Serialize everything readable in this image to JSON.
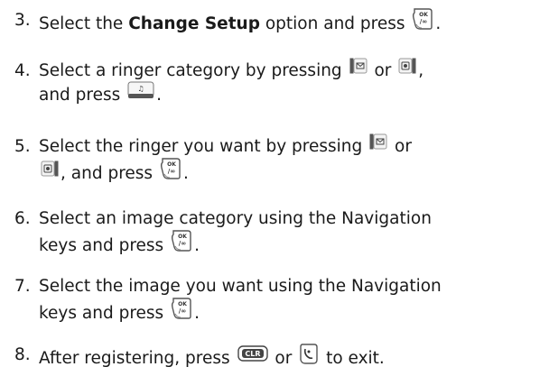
{
  "steps": [
    {
      "num": "3.",
      "parts": [
        {
          "t": "text",
          "v": "Select the "
        },
        {
          "t": "bold",
          "v": "Change Setup"
        },
        {
          "t": "text",
          "v": " option and press "
        },
        {
          "t": "icon",
          "icon": "ok-key-icon"
        },
        {
          "t": "text",
          "v": "."
        }
      ]
    },
    {
      "num": "4.",
      "parts": [
        {
          "t": "text",
          "v": "Select a ringer category by pressing "
        },
        {
          "t": "icon",
          "icon": "message-key-icon"
        },
        {
          "t": "text",
          "v": " or "
        },
        {
          "t": "icon",
          "icon": "phonebook-key-icon"
        },
        {
          "t": "text",
          "v": ","
        },
        {
          "t": "br"
        },
        {
          "t": "text",
          "v": "and press "
        },
        {
          "t": "icon",
          "icon": "music-softkey-icon"
        },
        {
          "t": "text",
          "v": "."
        }
      ]
    },
    {
      "num": "5.",
      "parts": [
        {
          "t": "text",
          "v": "Select the ringer you want by pressing "
        },
        {
          "t": "icon",
          "icon": "message-key-icon"
        },
        {
          "t": "text",
          "v": " or"
        },
        {
          "t": "br"
        },
        {
          "t": "icon",
          "icon": "phonebook-key-icon"
        },
        {
          "t": "text",
          "v": ", and press "
        },
        {
          "t": "icon",
          "icon": "ok-key-icon"
        },
        {
          "t": "text",
          "v": "."
        }
      ]
    },
    {
      "num": "6.",
      "parts": [
        {
          "t": "text",
          "v": "Select an image category using the Navigation"
        },
        {
          "t": "br"
        },
        {
          "t": "text",
          "v": "keys and press "
        },
        {
          "t": "icon",
          "icon": "ok-key-icon"
        },
        {
          "t": "text",
          "v": "."
        }
      ]
    },
    {
      "num": "7.",
      "parts": [
        {
          "t": "text",
          "v": "Select the image you want using the Navigation"
        },
        {
          "t": "br"
        },
        {
          "t": "text",
          "v": "keys and press "
        },
        {
          "t": "icon",
          "icon": "ok-key-icon"
        },
        {
          "t": "text",
          "v": "."
        }
      ]
    },
    {
      "num": "8.",
      "parts": [
        {
          "t": "text",
          "v": "After registering, press "
        },
        {
          "t": "icon",
          "icon": "clr-key-icon",
          "label": "CLR"
        },
        {
          "t": "text",
          "v": " or "
        },
        {
          "t": "icon",
          "icon": "end-key-icon"
        },
        {
          "t": "text",
          "v": " to exit."
        }
      ]
    }
  ]
}
